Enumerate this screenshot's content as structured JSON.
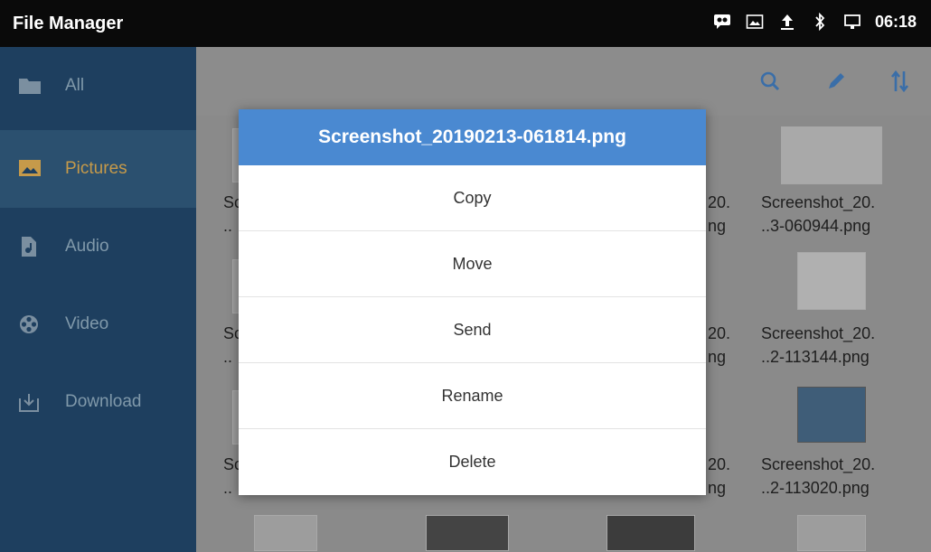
{
  "statusbar": {
    "app_title": "File Manager",
    "time": "06:18",
    "icons": [
      "voicemail-icon",
      "gallery-icon",
      "upload-icon",
      "bluetooth-icon",
      "display-icon"
    ]
  },
  "sidebar": {
    "items": [
      {
        "label": "All",
        "icon": "folder-icon"
      },
      {
        "label": "Pictures",
        "icon": "picture-icon",
        "selected": true
      },
      {
        "label": "Audio",
        "icon": "audio-icon"
      },
      {
        "label": "Video",
        "icon": "video-icon"
      },
      {
        "label": "Download",
        "icon": "download-icon"
      }
    ]
  },
  "toolbar": {
    "icons": [
      "search-icon",
      "edit-icon",
      "sort-icon"
    ]
  },
  "grid": {
    "rows": [
      {
        "col1": [
          "Sc",
          ".."
        ],
        "col3": [
          "20.",
          "ng"
        ],
        "col4": [
          "Screenshot_20.",
          "..3-060944.png"
        ]
      },
      {
        "col1": [
          "Sc",
          ".."
        ],
        "col3": [
          "20.",
          "ng"
        ],
        "col4": [
          "Screenshot_20.",
          "..2-113144.png"
        ]
      },
      {
        "col1": [
          "Sc",
          ".."
        ],
        "col3": [
          "20.",
          "ng"
        ],
        "col4": [
          "Screenshot_20.",
          "..2-113020.png"
        ]
      }
    ]
  },
  "dialog": {
    "title": "Screenshot_20190213-061814.png",
    "options": [
      "Copy",
      "Move",
      "Send",
      "Rename",
      "Delete"
    ]
  },
  "colors": {
    "accent": "#4a89d1",
    "sidebar_bg": "#1e3f5f",
    "selected_label": "#c69a4a"
  }
}
